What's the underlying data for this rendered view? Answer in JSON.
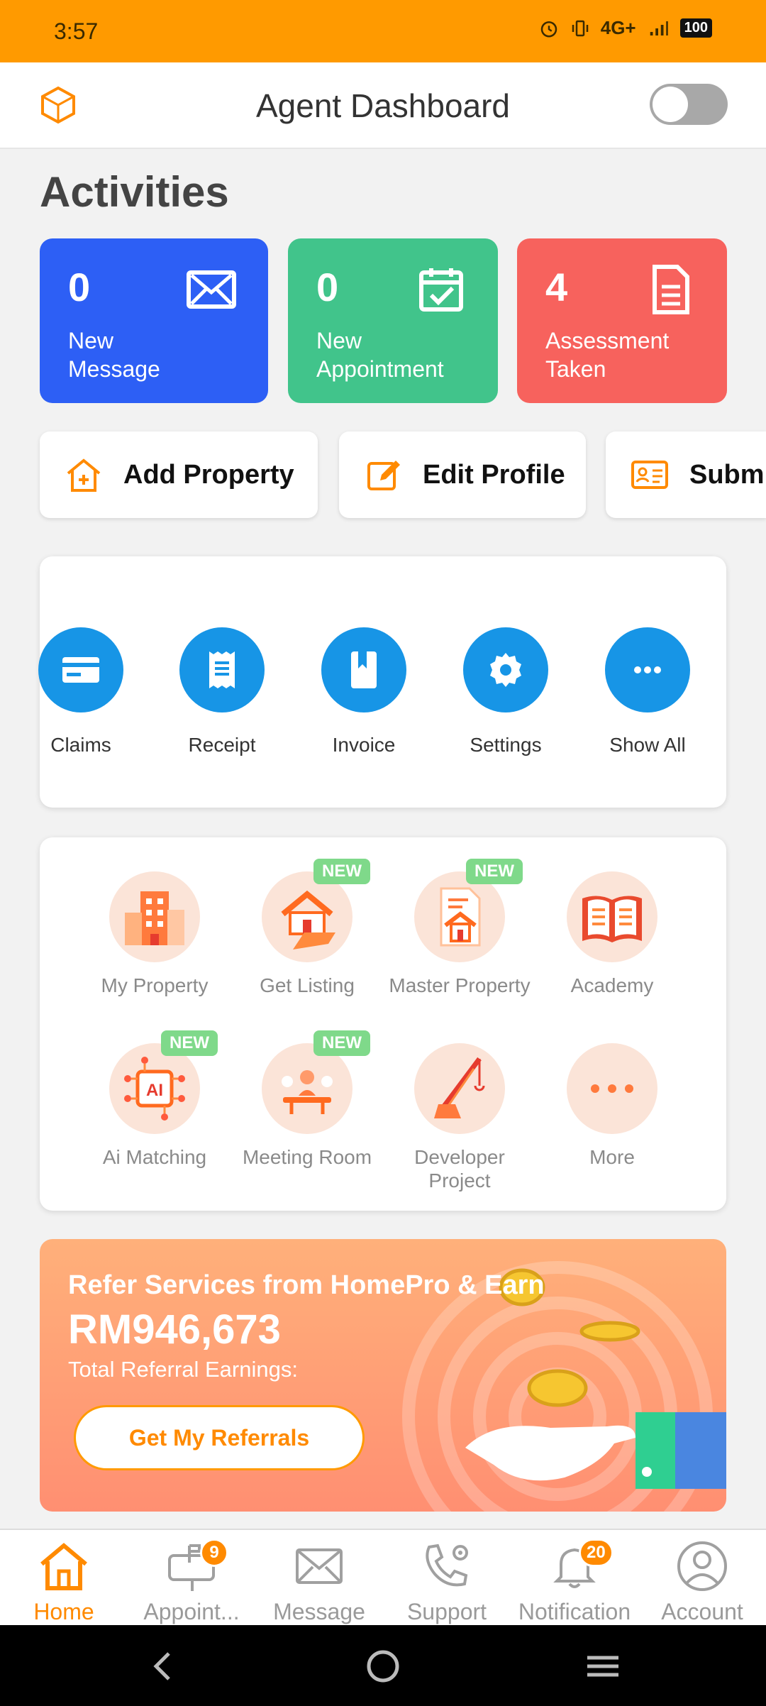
{
  "status_bar": {
    "time": "3:57",
    "network": "4G+",
    "battery": "100"
  },
  "header": {
    "title": "Agent Dashboard"
  },
  "activities": {
    "title": "Activities",
    "cards": [
      {
        "count": "0",
        "label_line1": "New",
        "label_line2": "Message",
        "color": "#2d5ff5"
      },
      {
        "count": "0",
        "label_line1": "New",
        "label_line2": "Appointment",
        "color": "#41c48b"
      },
      {
        "count": "4",
        "label_line1": "Assessment",
        "label_line2": "Taken",
        "color": "#f7625d"
      }
    ]
  },
  "quick_actions": [
    {
      "label": "Add Property",
      "icon": "house-plus-icon"
    },
    {
      "label": "Edit Profile",
      "icon": "edit-icon"
    },
    {
      "label": "Submi",
      "icon": "id-card-icon"
    }
  ],
  "services": [
    {
      "label": "Claims",
      "icon": "card-icon"
    },
    {
      "label": "Receipt",
      "icon": "receipt-icon"
    },
    {
      "label": "Invoice",
      "icon": "book-icon"
    },
    {
      "label": "Settings",
      "icon": "gear-icon"
    },
    {
      "label": "Show All",
      "icon": "more-icon"
    }
  ],
  "features": {
    "new_tag": "NEW",
    "items": [
      {
        "label": "My Property",
        "icon": "building-icon"
      },
      {
        "label": "Get Listing",
        "icon": "house-hand-icon"
      },
      {
        "label": "Master Property",
        "icon": "document-house-icon"
      },
      {
        "label": "Academy",
        "icon": "open-book-icon"
      },
      {
        "label": "Ai Matching",
        "icon": "ai-chip-icon"
      },
      {
        "label": "Meeting Room",
        "icon": "meeting-icon"
      },
      {
        "label_line1": "Developer",
        "label_line2": "Project",
        "icon": "crane-icon"
      },
      {
        "label": "More",
        "icon": "more-icon"
      }
    ]
  },
  "referral": {
    "heading": "Refer Services from HomePro & Earn",
    "amount": "RM946,673",
    "subtitle": "Total Referral Earnings:",
    "button": "Get My Referrals"
  },
  "bottom_nav": [
    {
      "label": "Home",
      "icon": "home-icon"
    },
    {
      "label": "Appoint...",
      "icon": "mailbox-icon",
      "badge": "9"
    },
    {
      "label": "Message",
      "icon": "envelope-icon"
    },
    {
      "label": "Support",
      "icon": "phone-gear-icon"
    },
    {
      "label": "Notification",
      "icon": "bell-icon",
      "badge": "20"
    },
    {
      "label": "Account",
      "icon": "user-icon"
    }
  ],
  "colors": {
    "accent": "#ff9a00",
    "service_blue": "#1795e6"
  }
}
